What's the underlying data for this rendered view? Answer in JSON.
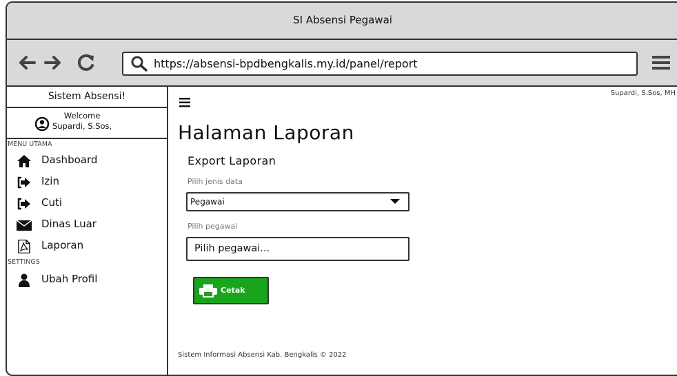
{
  "window": {
    "title": "SI Absensi Pegawai"
  },
  "browser": {
    "url": "https://absensi-bpdbengkalis.my.id/panel/report"
  },
  "sidebar": {
    "brand": "Sistem Absensi!",
    "welcome_label": "Welcome",
    "user_name": "Supardi, S.Sos,",
    "section_main": "MENU UTAMA",
    "items": [
      {
        "label": "Dashboard",
        "icon": "home-icon"
      },
      {
        "label": "Izin",
        "icon": "sign-in-icon"
      },
      {
        "label": "Cuti",
        "icon": "sign-in-icon"
      },
      {
        "label": "Dinas Luar",
        "icon": "envelope-icon"
      },
      {
        "label": "Laporan",
        "icon": "pdf-file-icon"
      }
    ],
    "section_settings": "SETTINGS",
    "settings_items": [
      {
        "label": "Ubah Profil",
        "icon": "user-icon"
      }
    ]
  },
  "header": {
    "user": "Supardi, S.Sos, MH"
  },
  "main": {
    "page_title": "Halaman Laporan",
    "section_title": "Export Laporan",
    "jenis_label": "Pilih jenis data",
    "jenis_value": "Pegawai",
    "pegawai_label": "Pilih pegawai",
    "pegawai_placeholder": "Pilih pegawai...",
    "print_button": "Cetak",
    "footer": "Sistem Informasi Absensi Kab. Bengkalis © 2022"
  },
  "colors": {
    "chrome": "#d9d9d9",
    "accent": "#19a51b",
    "border": "#333333"
  }
}
